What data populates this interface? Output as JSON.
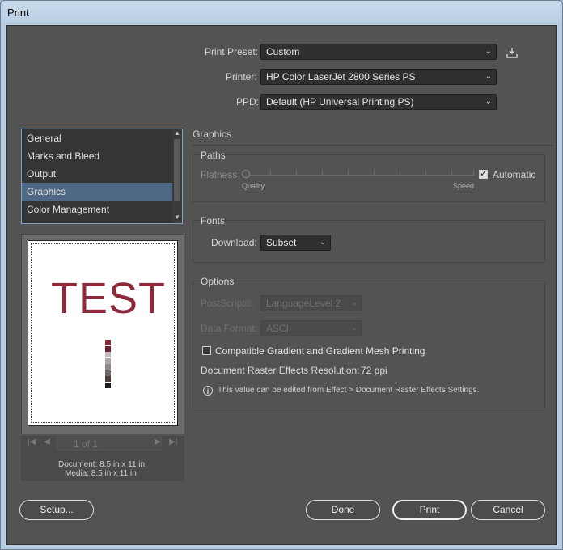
{
  "window": {
    "title": "Print"
  },
  "header": {
    "preset_label": "Print Preset:",
    "preset_value": "Custom",
    "printer_label": "Printer:",
    "printer_value": "HP Color LaserJet 2800 Series PS",
    "ppd_label": "PPD:",
    "ppd_value": "Default (HP Universal Printing PS)",
    "save_preset_icon": "save-preset-icon"
  },
  "sidebar": {
    "items": [
      {
        "label": "General"
      },
      {
        "label": "Marks and Bleed"
      },
      {
        "label": "Output"
      },
      {
        "label": "Graphics"
      },
      {
        "label": "Color Management"
      }
    ],
    "selected": "Graphics"
  },
  "preview": {
    "sample_text": "TEST",
    "swatch_colors": [
      "#8c2a3c",
      "#6d2030",
      "#c7b8bd",
      "#b0a8a8",
      "#908888",
      "#706868",
      "#4a3a3a",
      "#1e1e1e"
    ],
    "page_field": "1 of 1",
    "document_info": "Document: 8.5 in x 11 in",
    "media_info": "Media: 8.5 in x 11 in"
  },
  "graphics": {
    "section_title": "Graphics",
    "paths": {
      "title": "Paths",
      "flatness_label": "Flatness:",
      "quality_label": "Quality",
      "speed_label": "Speed",
      "automatic_label": "Automatic",
      "automatic_checked": true
    },
    "fonts": {
      "title": "Fonts",
      "download_label": "Download:",
      "download_value": "Subset"
    },
    "options": {
      "title": "Options",
      "postscript_label": "PostScript®:",
      "postscript_value": "LanguageLevel 2",
      "data_format_label": "Data Format:",
      "data_format_value": "ASCII",
      "compat_label": "Compatible Gradient and Gradient Mesh Printing",
      "compat_checked": false,
      "raster_label": "Document Raster Effects Resolution:",
      "raster_value": "72 ppi",
      "info_text": "This value can be edited from Effect > Document Raster Effects Settings."
    }
  },
  "footer": {
    "setup_label": "Setup...",
    "done_label": "Done",
    "print_label": "Print",
    "cancel_label": "Cancel"
  }
}
